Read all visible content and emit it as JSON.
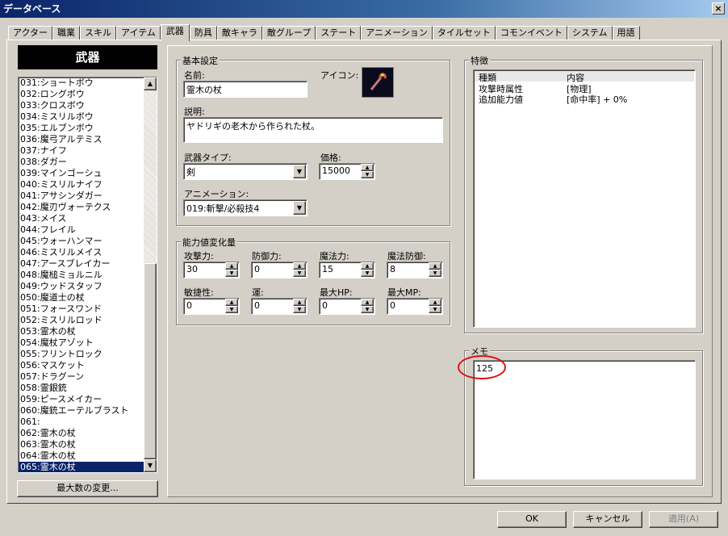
{
  "window": {
    "title": "データベース",
    "close_glyph": "×"
  },
  "tabs": [
    "アクター",
    "職業",
    "スキル",
    "アイテム",
    "武器",
    "防具",
    "敵キャラ",
    "敵グループ",
    "ステート",
    "アニメーション",
    "タイルセット",
    "コモンイベント",
    "システム",
    "用語"
  ],
  "active_tab": "武器",
  "list": {
    "header": "武器",
    "items": [
      "031:ショートボウ",
      "032:ロングボウ",
      "033:クロスボウ",
      "034:ミスリルボウ",
      "035:エルブンボウ",
      "036:魔弓アルテミス",
      "037:ナイフ",
      "038:ダガー",
      "039:マインゴーシュ",
      "040:ミスリルナイフ",
      "041:アサシンダガー",
      "042:魔刃ヴォーテクス",
      "043:メイス",
      "044:フレイル",
      "045:ウォーハンマー",
      "046:ミスリルメイス",
      "047:アースブレイカー",
      "048:魔槌ミョルニル",
      "049:ウッドスタッフ",
      "050:魔道士の杖",
      "051:フォースワンド",
      "052:ミスリルロッド",
      "053:霊木の杖",
      "054:魔杖アゾット",
      "055:フリントロック",
      "056:マスケット",
      "057:ドラグーン",
      "058:霊銀銃",
      "059:ピースメイカー",
      "060:魔銃エーテルブラスト",
      "061:",
      "062:霊木の杖",
      "063:霊木の杖",
      "064:霊木の杖",
      "065:霊木の杖"
    ],
    "selected_index": 34,
    "max_button": "最大数の変更..."
  },
  "basic": {
    "group_label": "基本設定",
    "name_label": "名前:",
    "name_value": "霊木の杖",
    "icon_label": "アイコン:",
    "icon": "staff-icon",
    "desc_label": "説明:",
    "desc_value": "ヤドリギの老木から作られた杖。",
    "type_label": "武器タイプ:",
    "type_value": "剣",
    "price_label": "価格:",
    "price_value": "15000",
    "anim_label": "アニメーション:",
    "anim_value": "019:斬撃/必殺技4"
  },
  "params": {
    "group_label": "能力値変化量",
    "fields": [
      {
        "label": "攻撃力:",
        "value": "30"
      },
      {
        "label": "防御力:",
        "value": "0"
      },
      {
        "label": "魔法力:",
        "value": "15"
      },
      {
        "label": "魔法防御:",
        "value": "8"
      },
      {
        "label": "敏捷性:",
        "value": "0"
      },
      {
        "label": "運:",
        "value": "0"
      },
      {
        "label": "最大HP:",
        "value": "0"
      },
      {
        "label": "最大MP:",
        "value": "0"
      }
    ]
  },
  "traits": {
    "group_label": "特徴",
    "col_type": "種類",
    "col_content": "内容",
    "rows": [
      {
        "type": "攻撃時属性",
        "content": "[物理]"
      },
      {
        "type": "追加能力値",
        "content": "[命中率] + 0%"
      }
    ]
  },
  "memo": {
    "group_label": "メモ",
    "value": "125",
    "highlight_color": "#e01010"
  },
  "buttons": {
    "ok": "OK",
    "cancel": "キャンセル",
    "apply": "適用(A)"
  }
}
